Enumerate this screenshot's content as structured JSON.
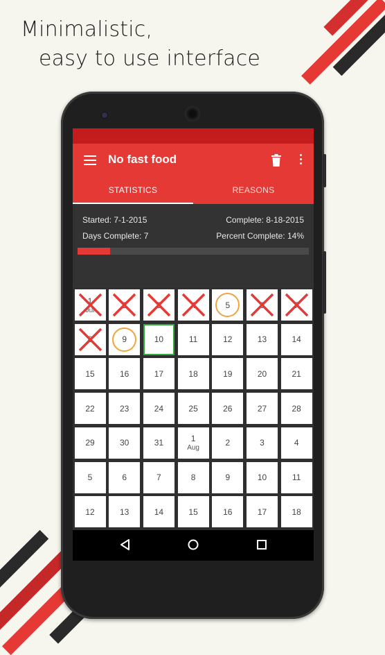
{
  "headline": {
    "line1": "Minimalistic,",
    "line2": "easy to use interface"
  },
  "app": {
    "title": "No fast food",
    "tabs": [
      {
        "label": "STATISTICS",
        "active": true
      },
      {
        "label": "REASONS",
        "active": false
      }
    ],
    "icons": {
      "menu": "hamburger-menu-icon",
      "delete": "trash-icon",
      "overflow": "more-vert-icon"
    }
  },
  "stats": {
    "started": "Started: 7-1-2015",
    "complete": "Complete: 8-18-2015",
    "days_complete": "Days Complete: 7",
    "percent_complete": "Percent Complete: 14%",
    "progress_percent": 14
  },
  "calendar": {
    "cells": [
      {
        "day": "1",
        "sub": "Jul",
        "mark": "x"
      },
      {
        "day": "2",
        "sub": "",
        "mark": "x"
      },
      {
        "day": "3",
        "sub": "",
        "mark": "x"
      },
      {
        "day": "4",
        "sub": "",
        "mark": "x"
      },
      {
        "day": "5",
        "sub": "",
        "mark": "o"
      },
      {
        "day": "6",
        "sub": "",
        "mark": "x"
      },
      {
        "day": "7",
        "sub": "",
        "mark": "x"
      },
      {
        "day": "8",
        "sub": "",
        "mark": "x"
      },
      {
        "day": "9",
        "sub": "",
        "mark": "o"
      },
      {
        "day": "10",
        "sub": "",
        "mark": "today"
      },
      {
        "day": "11",
        "sub": "",
        "mark": ""
      },
      {
        "day": "12",
        "sub": "",
        "mark": ""
      },
      {
        "day": "13",
        "sub": "",
        "mark": ""
      },
      {
        "day": "14",
        "sub": "",
        "mark": ""
      },
      {
        "day": "15",
        "sub": "",
        "mark": ""
      },
      {
        "day": "16",
        "sub": "",
        "mark": ""
      },
      {
        "day": "17",
        "sub": "",
        "mark": ""
      },
      {
        "day": "18",
        "sub": "",
        "mark": ""
      },
      {
        "day": "19",
        "sub": "",
        "mark": ""
      },
      {
        "day": "20",
        "sub": "",
        "mark": ""
      },
      {
        "day": "21",
        "sub": "",
        "mark": ""
      },
      {
        "day": "22",
        "sub": "",
        "mark": ""
      },
      {
        "day": "23",
        "sub": "",
        "mark": ""
      },
      {
        "day": "24",
        "sub": "",
        "mark": ""
      },
      {
        "day": "25",
        "sub": "",
        "mark": ""
      },
      {
        "day": "26",
        "sub": "",
        "mark": ""
      },
      {
        "day": "27",
        "sub": "",
        "mark": ""
      },
      {
        "day": "28",
        "sub": "",
        "mark": ""
      },
      {
        "day": "29",
        "sub": "",
        "mark": ""
      },
      {
        "day": "30",
        "sub": "",
        "mark": ""
      },
      {
        "day": "31",
        "sub": "",
        "mark": ""
      },
      {
        "day": "1",
        "sub": "Aug",
        "mark": ""
      },
      {
        "day": "2",
        "sub": "",
        "mark": ""
      },
      {
        "day": "3",
        "sub": "",
        "mark": ""
      },
      {
        "day": "4",
        "sub": "",
        "mark": ""
      },
      {
        "day": "5",
        "sub": "",
        "mark": ""
      },
      {
        "day": "6",
        "sub": "",
        "mark": ""
      },
      {
        "day": "7",
        "sub": "",
        "mark": ""
      },
      {
        "day": "8",
        "sub": "",
        "mark": ""
      },
      {
        "day": "9",
        "sub": "",
        "mark": ""
      },
      {
        "day": "10",
        "sub": "",
        "mark": ""
      },
      {
        "day": "11",
        "sub": "",
        "mark": ""
      },
      {
        "day": "12",
        "sub": "",
        "mark": ""
      },
      {
        "day": "13",
        "sub": "",
        "mark": ""
      },
      {
        "day": "14",
        "sub": "",
        "mark": ""
      },
      {
        "day": "15",
        "sub": "",
        "mark": ""
      },
      {
        "day": "16",
        "sub": "",
        "mark": ""
      },
      {
        "day": "17",
        "sub": "",
        "mark": ""
      },
      {
        "day": "18",
        "sub": "",
        "mark": ""
      }
    ]
  },
  "navbar": {
    "icons": [
      "back-icon",
      "home-icon",
      "recents-icon"
    ]
  },
  "colors": {
    "accent": "#e53935",
    "statusbar": "#c41c1c",
    "fail_mark": "#e53935",
    "partial_mark": "#f2a33a",
    "today_border": "#2faa3c",
    "background": "#f6f5ee"
  }
}
